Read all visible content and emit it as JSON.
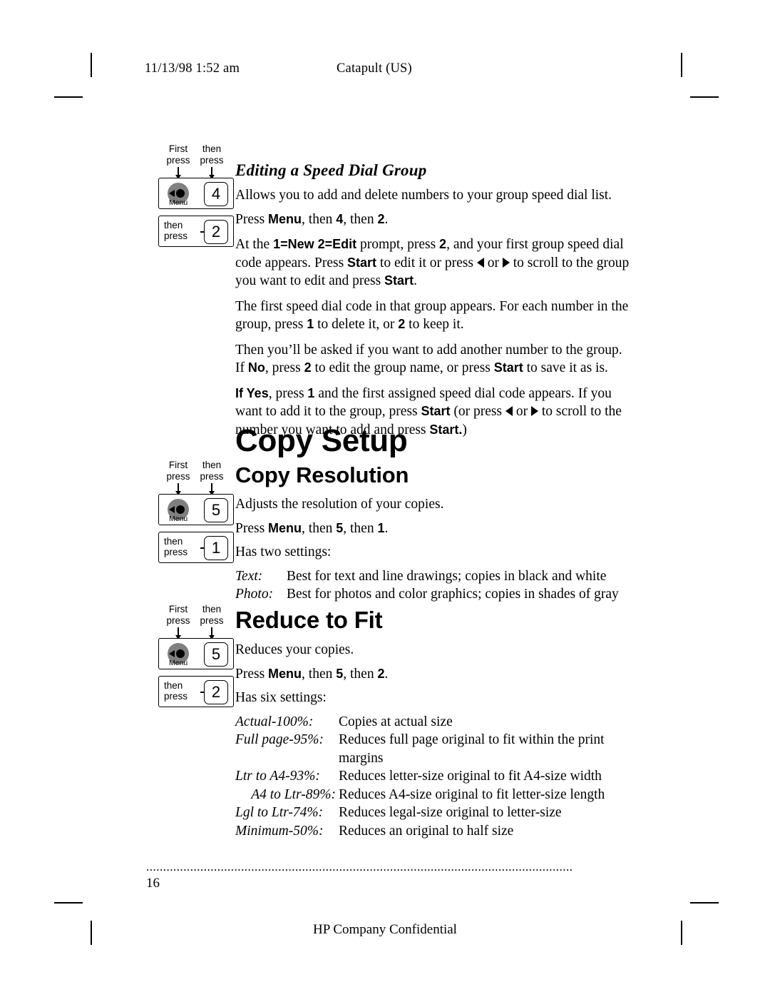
{
  "header": {
    "date": "11/13/98  1:52  am",
    "title": "Catapult (US)"
  },
  "footer": {
    "dots": "..............................................................................................................................",
    "page_number": "16",
    "confidential": "HP Company Confidential"
  },
  "keylabels": {
    "first": "First",
    "press": "press",
    "then": "then",
    "then_press_1": "then",
    "then_press_2": "press",
    "menu": "Menu"
  },
  "sections": [
    {
      "id": "editing-speed-dial-group",
      "heading": "Editing a Speed Dial Group",
      "heading_style": "italic-bold-serif",
      "keys": {
        "menu_digit": "4",
        "then_digit": "2"
      },
      "paragraphs": [
        "Allows you to add and delete numbers to your group speed dial list.",
        "Press Menu, then 4, then 2.",
        "At the 1=New 2=Edit prompt, press 2, and your first group speed dial code appears. Press Start to edit it or press ◀ or ▶ to scroll to the group you want to edit and press Start.",
        "The first speed dial code in that group appears. For each number in the group, press 1 to delete it, or 2 to keep it.",
        "Then you’ll be asked if you want to add another number to the group. If No, press 2 to edit the group name, or press Start to save it as is.",
        "If Yes, press 1 and the first assigned speed dial code appears. If you want to add it to the group, press Start (or press ◀ or ▶ to scroll to the number you want to add and press Start.)"
      ]
    },
    {
      "id": "copy-setup",
      "heading": "Copy Setup"
    },
    {
      "id": "copy-resolution",
      "heading": "Copy Resolution",
      "keys": {
        "menu_digit": "5",
        "then_digit": "1"
      },
      "paragraphs": [
        "Adjusts the resolution of your copies.",
        "Press Menu, then 5, then 1.",
        "Has two settings:"
      ],
      "definitions": [
        {
          "term": "Text:",
          "desc": "Best for text and line drawings; copies in black and white"
        },
        {
          "term": "Photo:",
          "desc": "Best for photos and color graphics; copies in shades of gray"
        }
      ]
    },
    {
      "id": "reduce-to-fit",
      "heading": "Reduce to Fit",
      "keys": {
        "menu_digit": "5",
        "then_digit": "2"
      },
      "paragraphs": [
        "Reduces your copies.",
        "Press Menu, then 5, then 2.",
        "Has six settings:"
      ],
      "definitions": [
        {
          "term": "Actual-100%:",
          "desc": "Copies at actual size"
        },
        {
          "term": "Full page-95%:",
          "desc": "Reduces full page original to fit within the print margins"
        },
        {
          "term": "Ltr to A4-93%:",
          "desc": "Reduces letter-size original to fit A4-size width"
        },
        {
          "term": "A4 to Ltr-89%:",
          "desc": "Reduces A4-size original to fit letter-size length"
        },
        {
          "term": "Lgl to Ltr-74%:",
          "desc": "Reduces legal-size original to letter-size"
        },
        {
          "term": "Minimum-50%:",
          "desc": "Reduces an original to half size"
        }
      ]
    }
  ]
}
